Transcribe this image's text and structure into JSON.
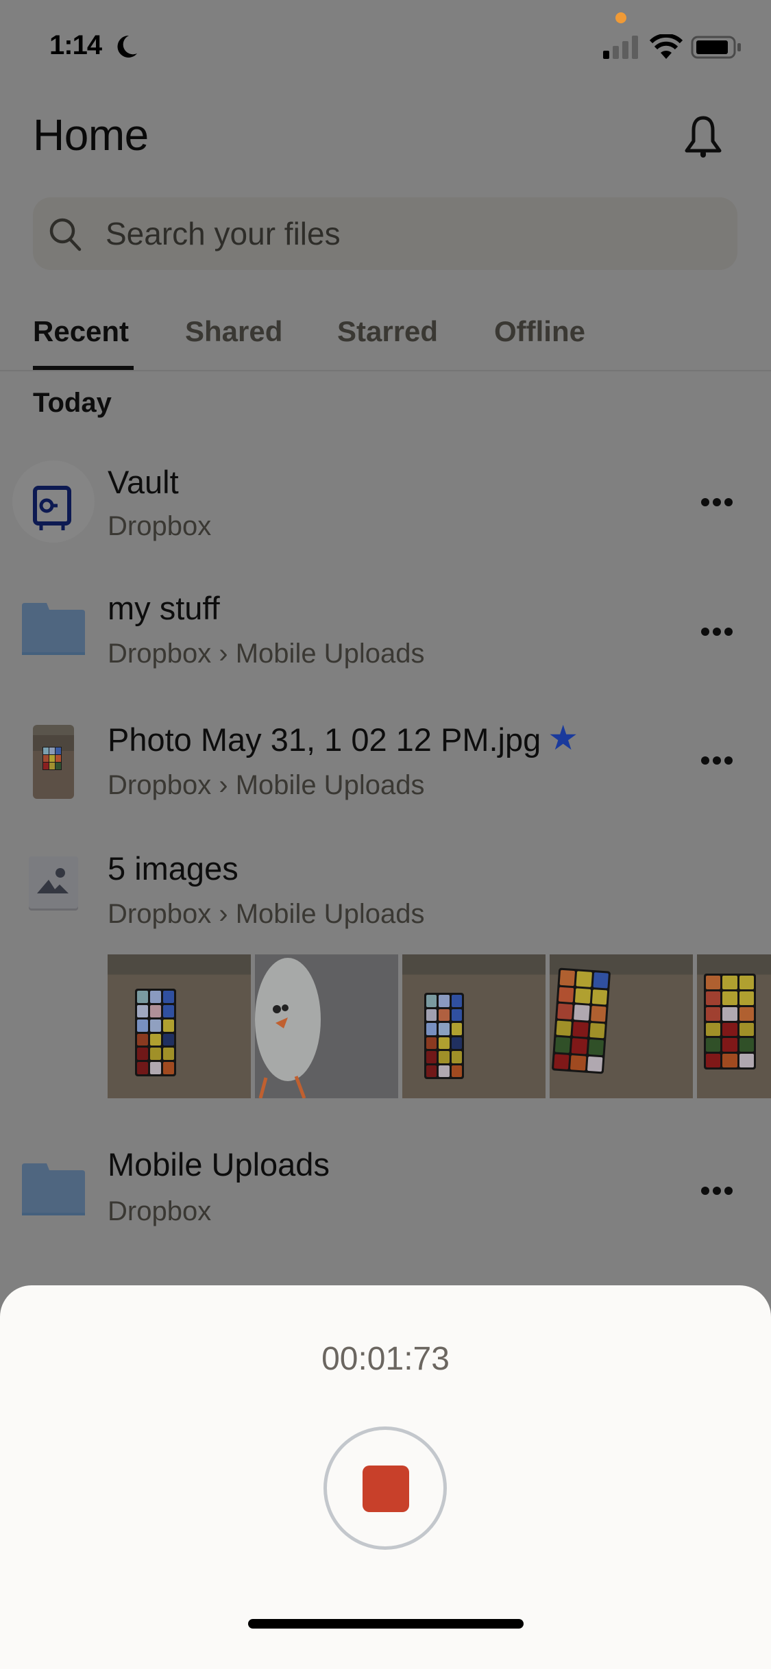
{
  "status_bar": {
    "time": "1:14",
    "icons": [
      "moon-icon",
      "signal-icon",
      "wifi-icon",
      "battery-icon"
    ],
    "privacy_dot_color": "#f09a36"
  },
  "header": {
    "title": "Home",
    "notification_icon": "bell-icon"
  },
  "search": {
    "placeholder": "Search your files",
    "value": "",
    "icon": "search-icon"
  },
  "tabs": [
    {
      "label": "Recent",
      "active": true
    },
    {
      "label": "Shared",
      "active": false
    },
    {
      "label": "Starred",
      "active": false
    },
    {
      "label": "Offline",
      "active": false
    }
  ],
  "section": {
    "title": "Today"
  },
  "items": [
    {
      "title": "Vault",
      "subtitle": "Dropbox",
      "icon": "vault-icon"
    },
    {
      "title": "my stuff",
      "subtitle": "Dropbox › Mobile Uploads",
      "icon": "folder-icon"
    },
    {
      "title": "Photo May 31, 1 02 12 PM.jpg",
      "subtitle": "Dropbox › Mobile Uploads",
      "icon": "photo-thumbnail",
      "starred": true,
      "star_glyph": "★"
    },
    {
      "title": "5 images",
      "subtitle": "Dropbox › Mobile Uploads",
      "icon": "image-icon",
      "thumbnails": [
        "rubiks-cube-photo",
        "egg-figure-photo",
        "rubiks-cube-photo",
        "rubiks-cube-photo",
        "rubiks-cube-photo"
      ]
    },
    {
      "title": "Mobile Uploads",
      "subtitle": "Dropbox",
      "icon": "folder-icon"
    }
  ],
  "recorder": {
    "elapsed": "00:01:73",
    "stop_icon": "stop-icon",
    "stop_color": "#c8402a"
  },
  "colors": {
    "folder": "#4f6680",
    "star": "#1a3a9c",
    "vault_icon": "#0d1a52"
  }
}
